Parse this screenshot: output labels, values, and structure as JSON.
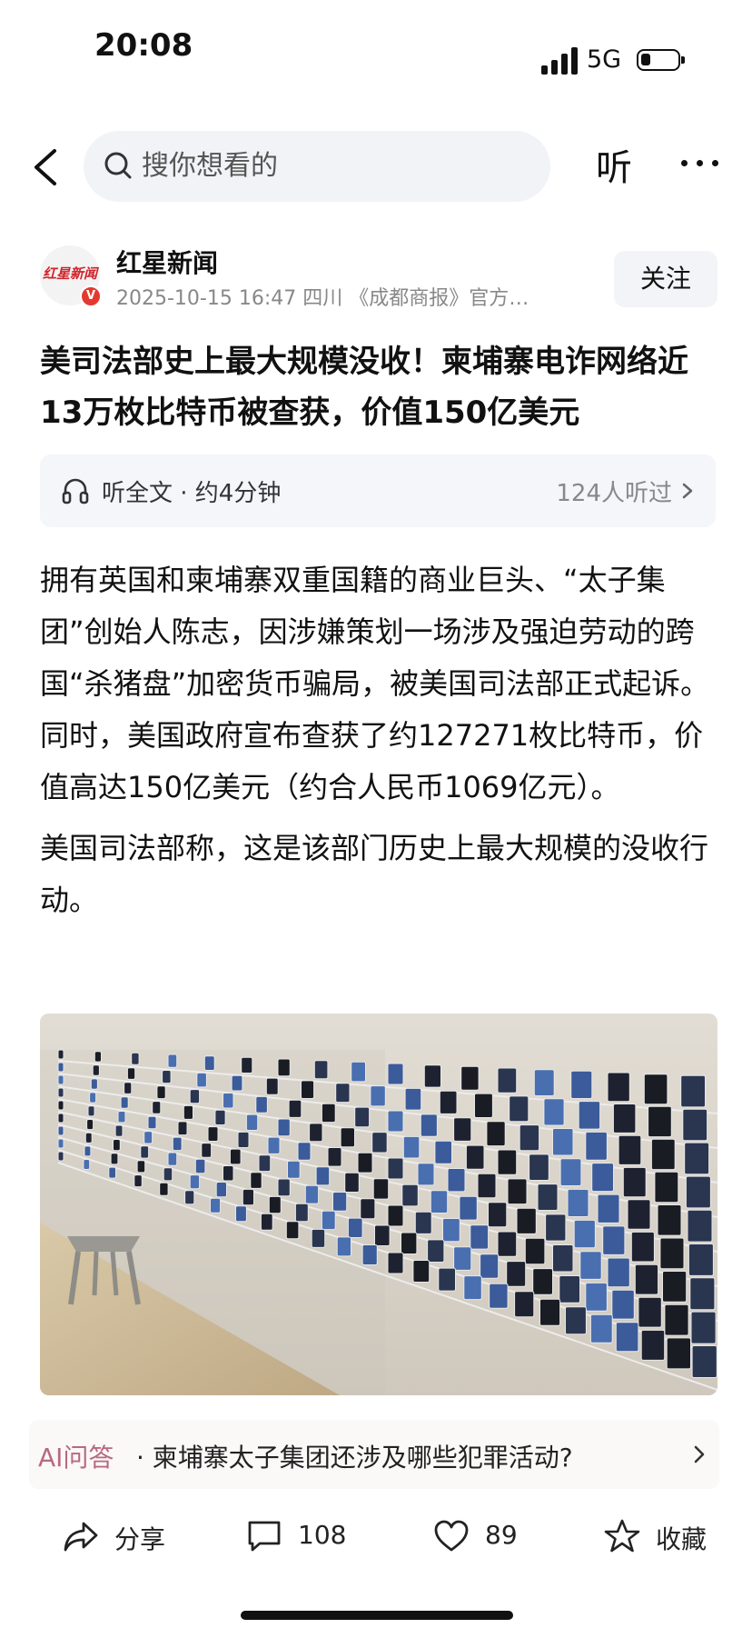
{
  "status_bar": {
    "time": "20:08",
    "network": "5G",
    "battery_level": 0.25
  },
  "header": {
    "search_placeholder": "搜你想看的",
    "listen_label": "听"
  },
  "author": {
    "avatar_text": "红星新闻",
    "verified_mark": "V",
    "name": "红星新闻",
    "meta": "2025-10-15 16:47 四川 《成都商报》官方…",
    "follow_label": "关注"
  },
  "article": {
    "headline": "美司法部史上最大规模没收！柬埔寨电诈网络近13万枚比特币被查获，价值150亿美元",
    "listen": {
      "label": "听全文 · 约4分钟",
      "count": "124人听过"
    },
    "paragraphs": [
      "拥有英国和柬埔寨双重国籍的商业巨头、“太子集团”创始人陈志，因涉嫌策划一场涉及强迫劳动的跨国“杀猪盘”加密货币骗局，被美国司法部正式起诉。同时，美国政府宣布查获了约127271枚比特币，价值高达150亿美元（约合人民币1069亿元）。",
      "美国司法部称，这是该部门历史上最大规模的没收行动。"
    ]
  },
  "ai_qa": {
    "label": "AI问答",
    "question": "· 柬埔寨太子集团还涉及哪些犯罪活动?"
  },
  "actions": {
    "share_label": "分享",
    "comments_count": "108",
    "likes_count": "89",
    "favorite_label": "收藏"
  },
  "colors": {
    "accent_red": "#e33a2f",
    "ai_label": "#b86a7d",
    "meta_gray": "#888888"
  }
}
